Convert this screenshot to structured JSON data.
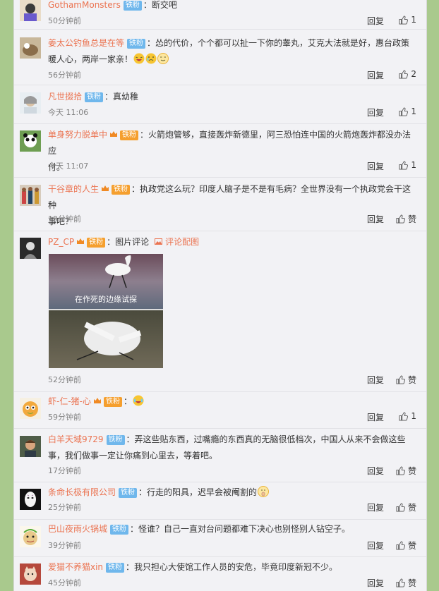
{
  "comments": [
    {
      "name": "GothamMonsters",
      "badge": "铁粉",
      "text": "：断交吧",
      "time": "50分钟前",
      "reply": "回复",
      "likes": "1"
    },
    {
      "name": "姜太公钓鱼总是在等",
      "badge": "铁粉",
      "text_line1": "：怂的代价，个个都可以扯一下你的睾丸，艾克大法就是好，惠台政策",
      "text_line2": "暖人心，两岸一家亲！",
      "time": "56分钟前",
      "reply": "回复",
      "likes": "2"
    },
    {
      "name": "凡世掇拾",
      "badge": "铁粉",
      "text": "：真幼稚",
      "time": "今天 11:06",
      "reply": "回复",
      "likes": "1"
    },
    {
      "name": "单身努力脱单中",
      "badge": "铁粉",
      "text_line1": "：火箭炮管够，直接轰炸新德里，阿三恐怕连中国的火箭炮轰炸都没办法应",
      "text_line2": "付。",
      "time": "今天 11:07",
      "reply": "回复",
      "likes": "1"
    },
    {
      "name": "干谷章的人生",
      "badge": "铁粉",
      "text_line1": "：执政党这么玩？印度人脑子是不是有毛病？全世界没有一个执政党会干这种",
      "text_line2": "事吧？",
      "time": "19分钟前",
      "reply": "回复",
      "likes": "赞"
    },
    {
      "name": "PZ_CP",
      "badge": "铁粉",
      "text": "：图片评论",
      "img_comment": "评论配图",
      "caption": "在作死的边缘试探",
      "time": "52分钟前",
      "reply": "回复",
      "likes": "赞"
    },
    {
      "name": "虾-仁-猪-心",
      "badge": "铁粉",
      "text": "：",
      "time": "59分钟前",
      "reply": "回复",
      "likes": "1"
    },
    {
      "name": "白羊天域9729",
      "badge": "铁粉",
      "text_line1": "：弄这些贴东西，过嘴瘾的东西真的无脑很低档次，中国人从来不会做这些",
      "text_line2": "事，我们做事一定让你痛到心里去，等着吧。",
      "time": "17分钟前",
      "reply": "回复",
      "likes": "赞"
    },
    {
      "name": "条命长极有限公司",
      "badge": "铁粉",
      "text": "：行走的阳具，迟早会被阉割的",
      "time": "25分钟前",
      "reply": "回复",
      "likes": "赞"
    },
    {
      "name": "巴山夜雨火锅城",
      "badge": "铁粉",
      "text": "：怪谁？自己一直对台问题都难下决心也别怪别人钻空子。",
      "time": "39分钟前",
      "reply": "回复",
      "likes": "赞"
    },
    {
      "name": "爱猫不养猫xin",
      "badge": "铁粉",
      "text": "：我只担心大使馆工作人员的安危，毕竟印度新冠不少。",
      "time": "45分钟前",
      "reply": "回复",
      "likes": "赞"
    }
  ]
}
